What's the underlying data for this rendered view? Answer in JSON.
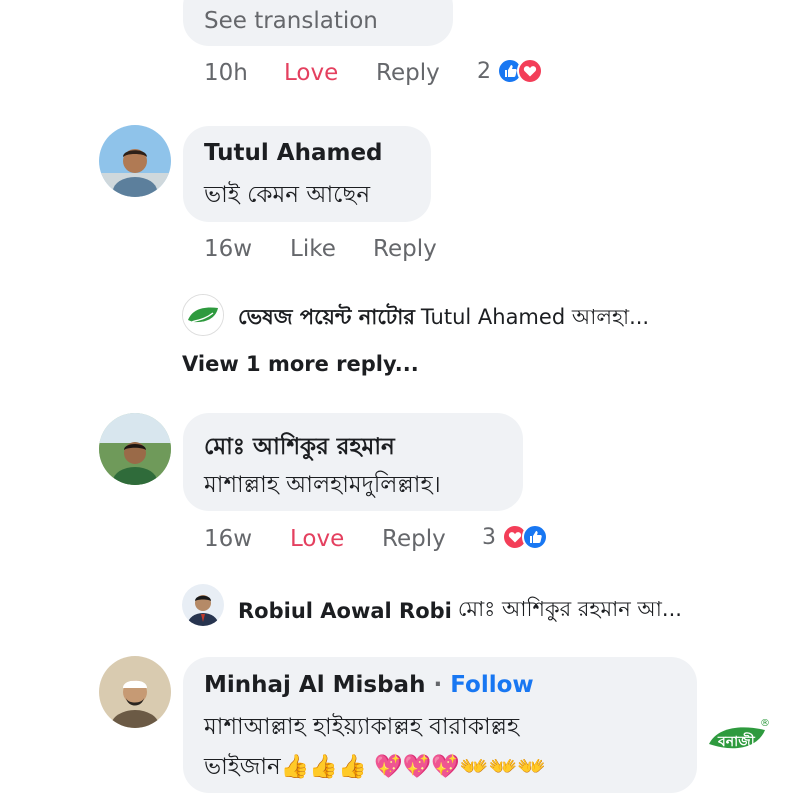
{
  "comment0": {
    "see_translation": "See translation",
    "time": "10h",
    "action1": "Love",
    "reply": "Reply",
    "reactions_count": "2"
  },
  "comment1": {
    "author": "Tutul Ahamed",
    "text": "ভাই কেমন আছেন",
    "time": "16w",
    "action1": "Like",
    "reply": "Reply"
  },
  "reply1": {
    "author": "ভেষজ পয়েন্ট নাটোর",
    "snippet": "Tutul Ahamed আলহা..."
  },
  "view_more": "View 1 more reply...",
  "comment2": {
    "author": "মোঃ আশিকুর রহমান",
    "text": "মাশাল্লাহ আলহামদুলিল্লাহ।",
    "time": "16w",
    "action1": "Love",
    "reply": "Reply",
    "reactions_count": "3"
  },
  "reply2": {
    "author": "Robiul Aowal Robi",
    "snippet": "মোঃ আশিকুর রহমান আ..."
  },
  "comment3": {
    "author": "Minhaj Al Misbah",
    "dot": "·",
    "follow": "Follow",
    "line1": "মাশাআল্লাহ হাইয়্যাকাল্লহ বারাকাল্লহ",
    "line2": "ভাইজান👍👍👍 💖💖💖👐👐👐"
  },
  "watermark": {
    "text": "বনাজী",
    "mark": "®"
  },
  "colors": {
    "like_blue": "#1877f2",
    "love_red": "#f33e58",
    "follow_blue": "#1877f2",
    "bubble_gray": "#f0f2f5"
  }
}
